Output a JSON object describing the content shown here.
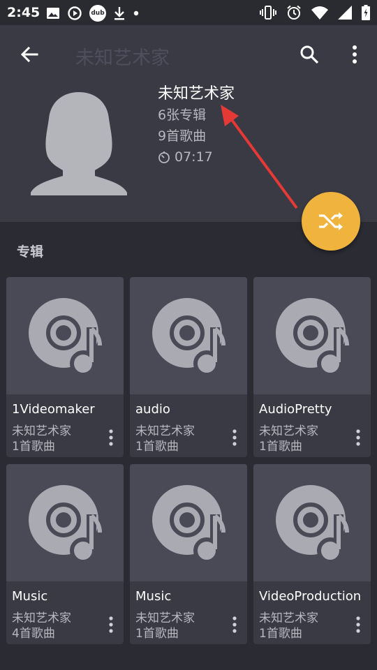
{
  "status_bar": {
    "time": "2:45",
    "left_icons": [
      "image-icon",
      "sync-play-icon",
      "dub-icon",
      "download-icon",
      "dot-icon"
    ],
    "dub_text": "dub",
    "right_icons": [
      "vibrate-icon",
      "alarm-icon",
      "wifi-icon",
      "signal-icon",
      "battery-icon"
    ]
  },
  "toolbar": {
    "title": "未知艺术家"
  },
  "artist": {
    "name": "未知艺术家",
    "albums": "6张专辑",
    "songs": "9首歌曲",
    "duration": "07:17"
  },
  "section": {
    "title": "专辑"
  },
  "albums": [
    {
      "name": "1Videomaker",
      "artist": "未知艺术家",
      "count": "1首歌曲"
    },
    {
      "name": "audio",
      "artist": "未知艺术家",
      "count": "1首歌曲"
    },
    {
      "name": "AudioPretty",
      "artist": "未知艺术家",
      "count": "1首歌曲"
    },
    {
      "name": "Music",
      "artist": "未知艺术家",
      "count": "4首歌曲"
    },
    {
      "name": "Music",
      "artist": "未知艺术家",
      "count": "1首歌曲"
    },
    {
      "name": "VideoProduction",
      "artist": "未知艺术家",
      "count": "1首歌曲"
    }
  ],
  "colors": {
    "accent": "#f0b33e",
    "annotation_arrow": "#e53935",
    "header_bg": "#3a3a45",
    "page_bg": "#2b2b33"
  }
}
